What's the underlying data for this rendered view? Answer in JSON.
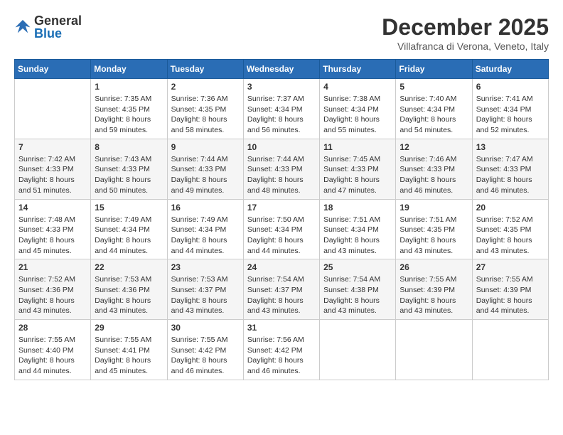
{
  "header": {
    "logo_general": "General",
    "logo_blue": "Blue",
    "month_title": "December 2025",
    "subtitle": "Villafranca di Verona, Veneto, Italy"
  },
  "weekdays": [
    "Sunday",
    "Monday",
    "Tuesday",
    "Wednesday",
    "Thursday",
    "Friday",
    "Saturday"
  ],
  "weeks": [
    [
      {
        "day": "",
        "info": ""
      },
      {
        "day": "1",
        "info": "Sunrise: 7:35 AM\nSunset: 4:35 PM\nDaylight: 8 hours\nand 59 minutes."
      },
      {
        "day": "2",
        "info": "Sunrise: 7:36 AM\nSunset: 4:35 PM\nDaylight: 8 hours\nand 58 minutes."
      },
      {
        "day": "3",
        "info": "Sunrise: 7:37 AM\nSunset: 4:34 PM\nDaylight: 8 hours\nand 56 minutes."
      },
      {
        "day": "4",
        "info": "Sunrise: 7:38 AM\nSunset: 4:34 PM\nDaylight: 8 hours\nand 55 minutes."
      },
      {
        "day": "5",
        "info": "Sunrise: 7:40 AM\nSunset: 4:34 PM\nDaylight: 8 hours\nand 54 minutes."
      },
      {
        "day": "6",
        "info": "Sunrise: 7:41 AM\nSunset: 4:34 PM\nDaylight: 8 hours\nand 52 minutes."
      }
    ],
    [
      {
        "day": "7",
        "info": "Sunrise: 7:42 AM\nSunset: 4:33 PM\nDaylight: 8 hours\nand 51 minutes."
      },
      {
        "day": "8",
        "info": "Sunrise: 7:43 AM\nSunset: 4:33 PM\nDaylight: 8 hours\nand 50 minutes."
      },
      {
        "day": "9",
        "info": "Sunrise: 7:44 AM\nSunset: 4:33 PM\nDaylight: 8 hours\nand 49 minutes."
      },
      {
        "day": "10",
        "info": "Sunrise: 7:44 AM\nSunset: 4:33 PM\nDaylight: 8 hours\nand 48 minutes."
      },
      {
        "day": "11",
        "info": "Sunrise: 7:45 AM\nSunset: 4:33 PM\nDaylight: 8 hours\nand 47 minutes."
      },
      {
        "day": "12",
        "info": "Sunrise: 7:46 AM\nSunset: 4:33 PM\nDaylight: 8 hours\nand 46 minutes."
      },
      {
        "day": "13",
        "info": "Sunrise: 7:47 AM\nSunset: 4:33 PM\nDaylight: 8 hours\nand 46 minutes."
      }
    ],
    [
      {
        "day": "14",
        "info": "Sunrise: 7:48 AM\nSunset: 4:33 PM\nDaylight: 8 hours\nand 45 minutes."
      },
      {
        "day": "15",
        "info": "Sunrise: 7:49 AM\nSunset: 4:34 PM\nDaylight: 8 hours\nand 44 minutes."
      },
      {
        "day": "16",
        "info": "Sunrise: 7:49 AM\nSunset: 4:34 PM\nDaylight: 8 hours\nand 44 minutes."
      },
      {
        "day": "17",
        "info": "Sunrise: 7:50 AM\nSunset: 4:34 PM\nDaylight: 8 hours\nand 44 minutes."
      },
      {
        "day": "18",
        "info": "Sunrise: 7:51 AM\nSunset: 4:34 PM\nDaylight: 8 hours\nand 43 minutes."
      },
      {
        "day": "19",
        "info": "Sunrise: 7:51 AM\nSunset: 4:35 PM\nDaylight: 8 hours\nand 43 minutes."
      },
      {
        "day": "20",
        "info": "Sunrise: 7:52 AM\nSunset: 4:35 PM\nDaylight: 8 hours\nand 43 minutes."
      }
    ],
    [
      {
        "day": "21",
        "info": "Sunrise: 7:52 AM\nSunset: 4:36 PM\nDaylight: 8 hours\nand 43 minutes."
      },
      {
        "day": "22",
        "info": "Sunrise: 7:53 AM\nSunset: 4:36 PM\nDaylight: 8 hours\nand 43 minutes."
      },
      {
        "day": "23",
        "info": "Sunrise: 7:53 AM\nSunset: 4:37 PM\nDaylight: 8 hours\nand 43 minutes."
      },
      {
        "day": "24",
        "info": "Sunrise: 7:54 AM\nSunset: 4:37 PM\nDaylight: 8 hours\nand 43 minutes."
      },
      {
        "day": "25",
        "info": "Sunrise: 7:54 AM\nSunset: 4:38 PM\nDaylight: 8 hours\nand 43 minutes."
      },
      {
        "day": "26",
        "info": "Sunrise: 7:55 AM\nSunset: 4:39 PM\nDaylight: 8 hours\nand 43 minutes."
      },
      {
        "day": "27",
        "info": "Sunrise: 7:55 AM\nSunset: 4:39 PM\nDaylight: 8 hours\nand 44 minutes."
      }
    ],
    [
      {
        "day": "28",
        "info": "Sunrise: 7:55 AM\nSunset: 4:40 PM\nDaylight: 8 hours\nand 44 minutes."
      },
      {
        "day": "29",
        "info": "Sunrise: 7:55 AM\nSunset: 4:41 PM\nDaylight: 8 hours\nand 45 minutes."
      },
      {
        "day": "30",
        "info": "Sunrise: 7:55 AM\nSunset: 4:42 PM\nDaylight: 8 hours\nand 46 minutes."
      },
      {
        "day": "31",
        "info": "Sunrise: 7:56 AM\nSunset: 4:42 PM\nDaylight: 8 hours\nand 46 minutes."
      },
      {
        "day": "",
        "info": ""
      },
      {
        "day": "",
        "info": ""
      },
      {
        "day": "",
        "info": ""
      }
    ]
  ]
}
